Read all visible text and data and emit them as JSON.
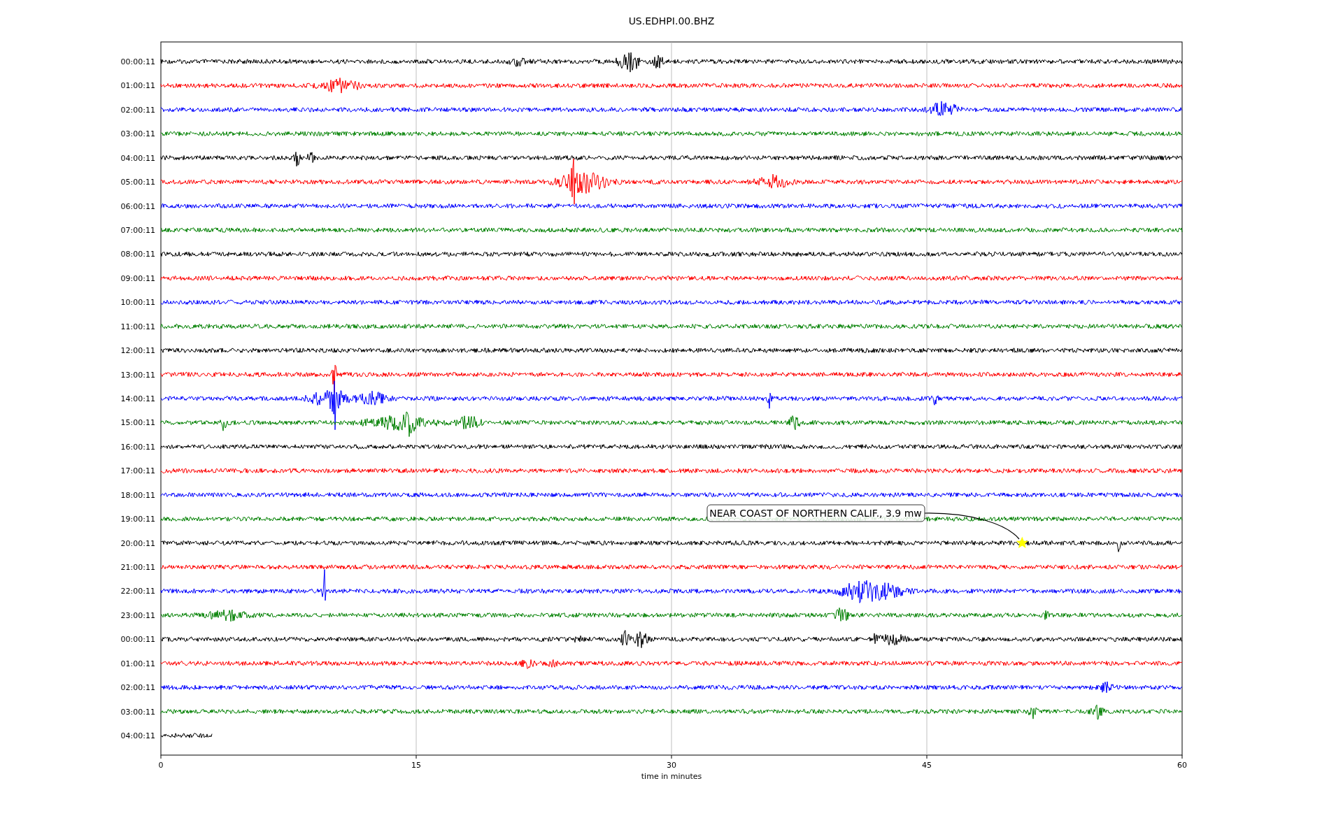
{
  "title": "US.EDHPI.00.BHZ",
  "traces": [
    {
      "label": "00:00:11",
      "color": "#000000",
      "kind": "full"
    },
    {
      "label": "01:00:11",
      "color": "#ff0000",
      "kind": "full"
    },
    {
      "label": "02:00:11",
      "color": "#0000ff",
      "kind": "full"
    },
    {
      "label": "03:00:11",
      "color": "#008000",
      "kind": "full"
    },
    {
      "label": "04:00:11",
      "color": "#000000",
      "kind": "full"
    },
    {
      "label": "05:00:11",
      "color": "#ff0000",
      "kind": "full"
    },
    {
      "label": "06:00:11",
      "color": "#0000ff",
      "kind": "full"
    },
    {
      "label": "07:00:11",
      "color": "#008000",
      "kind": "full"
    },
    {
      "label": "08:00:11",
      "color": "#000000",
      "kind": "full"
    },
    {
      "label": "09:00:11",
      "color": "#ff0000",
      "kind": "full"
    },
    {
      "label": "10:00:11",
      "color": "#0000ff",
      "kind": "full"
    },
    {
      "label": "11:00:11",
      "color": "#008000",
      "kind": "full"
    },
    {
      "label": "12:00:11",
      "color": "#000000",
      "kind": "full"
    },
    {
      "label": "13:00:11",
      "color": "#ff0000",
      "kind": "full"
    },
    {
      "label": "14:00:11",
      "color": "#0000ff",
      "kind": "full"
    },
    {
      "label": "15:00:11",
      "color": "#008000",
      "kind": "full"
    },
    {
      "label": "16:00:11",
      "color": "#000000",
      "kind": "full"
    },
    {
      "label": "17:00:11",
      "color": "#ff0000",
      "kind": "full"
    },
    {
      "label": "18:00:11",
      "color": "#0000ff",
      "kind": "full"
    },
    {
      "label": "19:00:11",
      "color": "#008000",
      "kind": "full"
    },
    {
      "label": "20:00:11",
      "color": "#000000",
      "kind": "full"
    },
    {
      "label": "21:00:11",
      "color": "#ff0000",
      "kind": "full"
    },
    {
      "label": "22:00:11",
      "color": "#0000ff",
      "kind": "full"
    },
    {
      "label": "23:00:11",
      "color": "#008000",
      "kind": "full"
    },
    {
      "label": "00:00:11",
      "color": "#000000",
      "kind": "full"
    },
    {
      "label": "01:00:11",
      "color": "#ff0000",
      "kind": "full"
    },
    {
      "label": "02:00:11",
      "color": "#0000ff",
      "kind": "full"
    },
    {
      "label": "03:00:11",
      "color": "#008000",
      "kind": "full"
    },
    {
      "label": "04:00:11",
      "color": "#000000",
      "kind": "partial"
    }
  ],
  "x_axis": {
    "label": "time in minutes",
    "ticks": [
      "0",
      "15",
      "30",
      "45",
      "60"
    ]
  },
  "annotation": {
    "text": "NEAR COAST OF NORTHERN CALIF., 3.9 mw"
  }
}
